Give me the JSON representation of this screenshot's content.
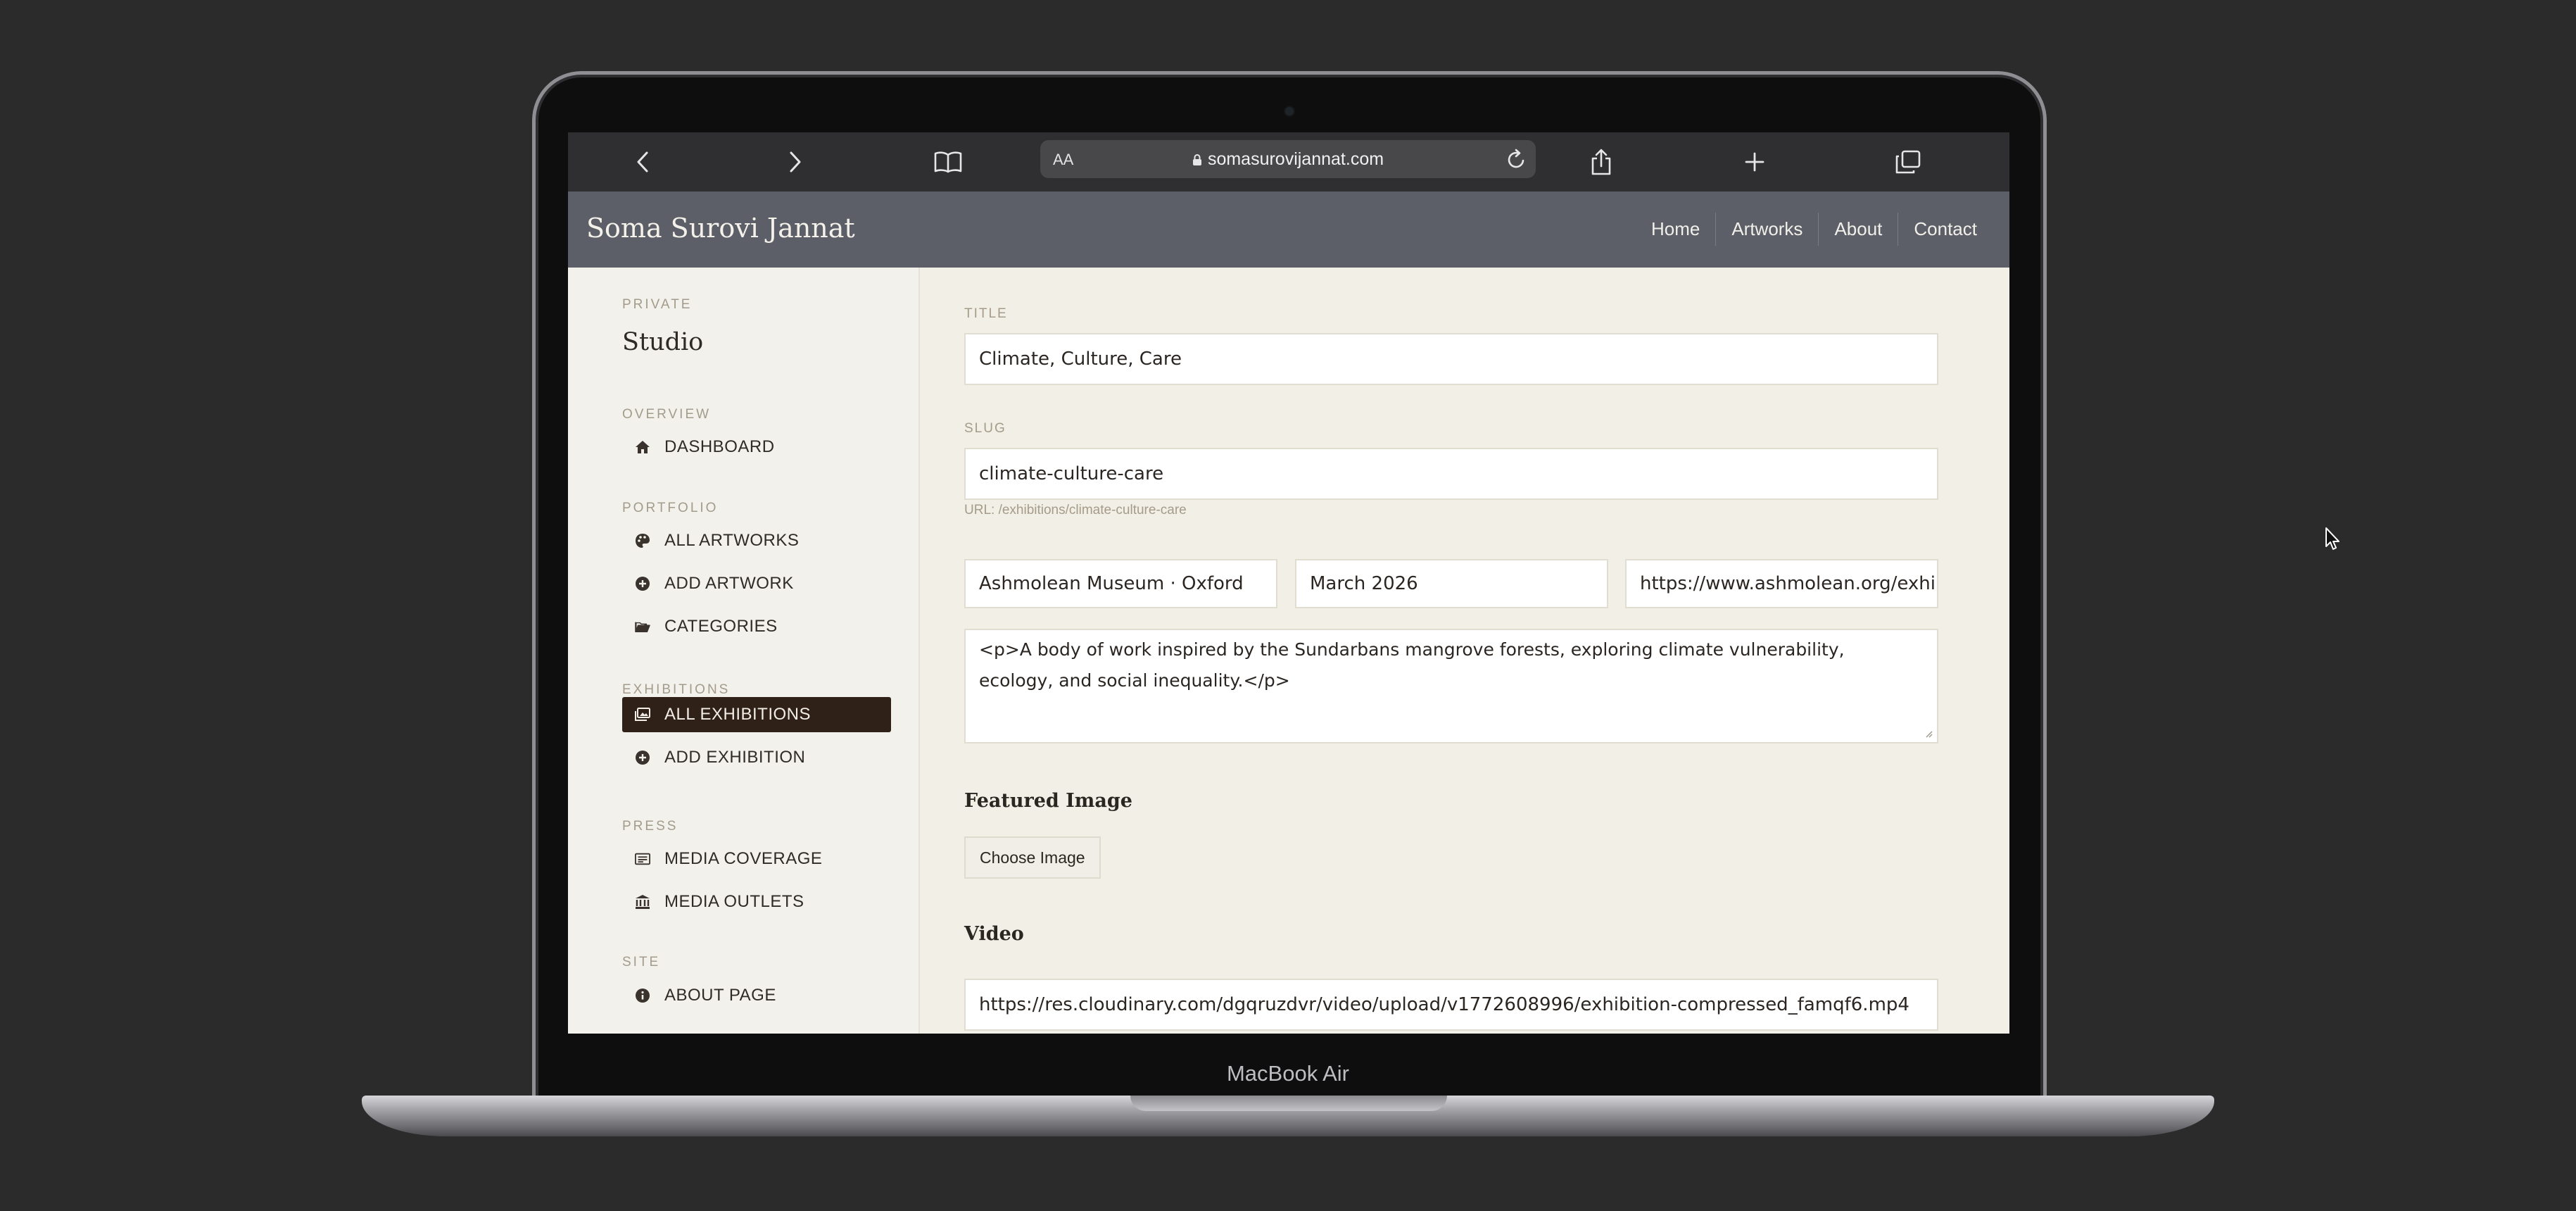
{
  "device": {
    "label": "MacBook Air"
  },
  "browser": {
    "reader_label": "AA",
    "address": "somasurovijannat.com"
  },
  "site": {
    "brand": "Soma Surovi Jannat",
    "nav": [
      "Home",
      "Artworks",
      "About",
      "Contact"
    ]
  },
  "sidebar": {
    "eyebrow": "PRIVATE",
    "title": "Studio",
    "sections": {
      "overview": "OVERVIEW",
      "portfolio": "PORTFOLIO",
      "exhibitions": "EXHIBITIONS",
      "press": "PRESS",
      "site": "SITE"
    },
    "items": {
      "dashboard": "DASHBOARD",
      "all_artworks": "ALL ARTWORKS",
      "add_artwork": "ADD ARTWORK",
      "categories": "CATEGORIES",
      "all_exhibitions": "ALL EXHIBITIONS",
      "add_exhibition": "ADD EXHIBITION",
      "media_coverage": "MEDIA COVERAGE",
      "media_outlets": "MEDIA OUTLETS",
      "about_page": "ABOUT PAGE"
    },
    "active": "all_exhibitions"
  },
  "form": {
    "title_label": "TITLE",
    "title_value": "Climate, Culture, Care",
    "slug_label": "SLUG",
    "slug_value": "climate-culture-care",
    "url_hint": "URL: /exhibitions/climate-culture-care",
    "venue_value": "Ashmolean Museum · Oxford",
    "date_value": "March 2026",
    "link_value": "https://www.ashmolean.org/exhi",
    "description_value": "<p>A body of work inspired by the Sundarbans mangrove forests, exploring climate vulnerability, ecology, and social inequality.</p>",
    "featured_image_heading": "Featured Image",
    "choose_image_label": "Choose Image",
    "video_heading": "Video",
    "video_value": "https://res.cloudinary.com/dgqruzdvr/video/upload/v1772608996/exhibition-compressed_famqf6.mp4"
  }
}
